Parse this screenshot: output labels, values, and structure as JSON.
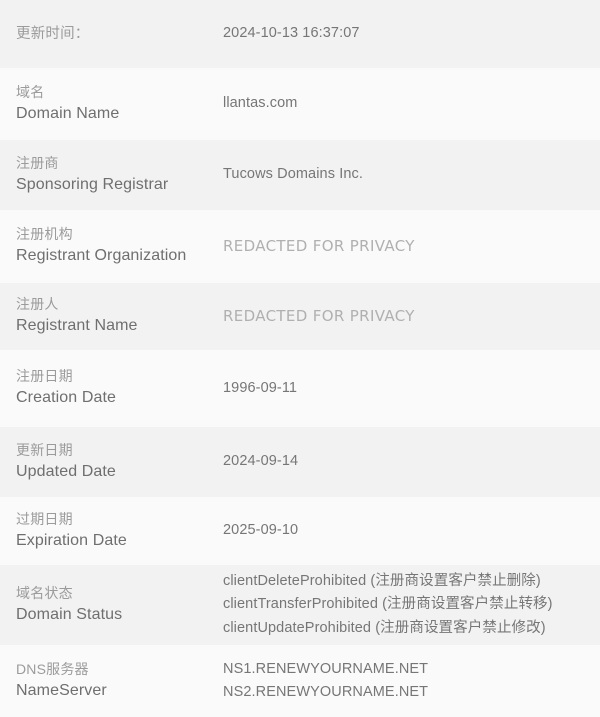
{
  "page": {
    "title": "WHOIS 域名信息",
    "colors": {
      "row_shaded_bg": "#f2f2f2",
      "row_light_bg": "#fafafa",
      "label_cn_text": "#9b9b9b",
      "label_en_text": "#6f6f6f",
      "value_text": "#767676",
      "redacted_text": "#b0b0b0"
    }
  },
  "rows": [
    {
      "label_cn": "更新时间：",
      "label_en": "",
      "values": [
        "2024-10-13 16:37:07"
      ],
      "redacted": false
    },
    {
      "label_cn": "域名",
      "label_en": "Domain Name",
      "values": [
        "llantas.com"
      ],
      "redacted": false
    },
    {
      "label_cn": "注册商",
      "label_en": "Sponsoring Registrar",
      "values": [
        "Tucows Domains Inc."
      ],
      "redacted": false
    },
    {
      "label_cn": "注册机构",
      "label_en": "Registrant Organization",
      "values": [
        "REDACTED FOR PRIVACY"
      ],
      "redacted": true
    },
    {
      "label_cn": "注册人",
      "label_en": "Registrant Name",
      "values": [
        "REDACTED FOR PRIVACY"
      ],
      "redacted": true
    },
    {
      "label_cn": "注册日期",
      "label_en": "Creation Date",
      "values": [
        "1996-09-11"
      ],
      "redacted": false
    },
    {
      "label_cn": "更新日期",
      "label_en": "Updated Date",
      "values": [
        "2024-09-14"
      ],
      "redacted": false
    },
    {
      "label_cn": "过期日期",
      "label_en": "Expiration Date",
      "values": [
        "2025-09-10"
      ],
      "redacted": false
    },
    {
      "label_cn": "域名状态",
      "label_en": "Domain Status",
      "values": [
        "clientDeleteProhibited (注册商设置客户禁止删除)",
        "clientTransferProhibited (注册商设置客户禁止转移)",
        "clientUpdateProhibited (注册商设置客户禁止修改)"
      ],
      "redacted": false
    },
    {
      "label_cn": "DNS服务器",
      "label_en": "NameServer",
      "values": [
        "NS1.RENEWYOURNAME.NET",
        "NS2.RENEWYOURNAME.NET"
      ],
      "redacted": false
    }
  ]
}
